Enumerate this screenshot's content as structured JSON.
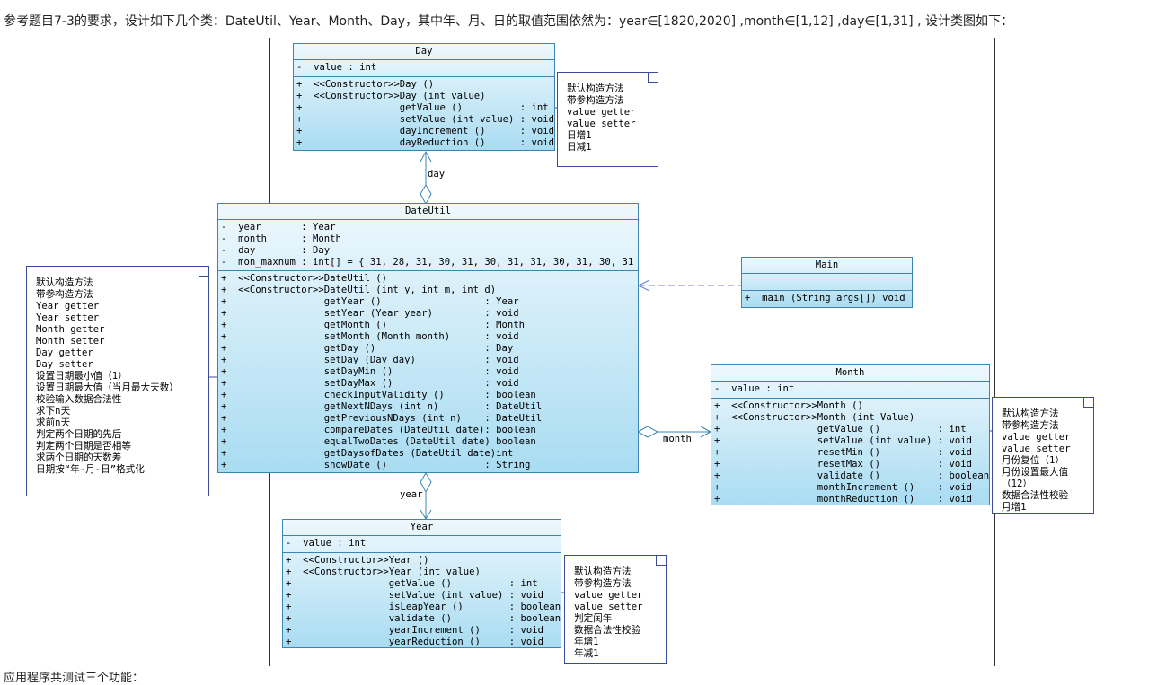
{
  "intro_text": "参考题目7-3的要求，设计如下几个类：DateUtil、Year、Month、Day，其中年、月、日的取值范围依然为：year∈[1820,2020] ,month∈[1,12] ,day∈[1,31] , 设计类图如下：",
  "footer_text": "应用程序共测试三个功能：",
  "classes": {
    "day": {
      "name": "Day",
      "attributes": [
        "-  value : int"
      ],
      "methods": [
        "+  <<Constructor>>Day ()",
        "+  <<Constructor>>Day (int value)",
        "+                 getValue ()          : int",
        "+                 setValue (int value) : void",
        "+                 dayIncrement ()      : void",
        "+                 dayReduction ()      : void"
      ]
    },
    "dateutil": {
      "name": "DateUtil",
      "attributes": [
        "-  year       : Year",
        "-  month      : Month",
        "-  day        : Day",
        "-  mon_maxnum : int[] = { 31, 28, 31, 30, 31, 30, 31, 31, 30, 31, 30, 31 }"
      ],
      "methods": [
        "+  <<Constructor>>DateUtil ()",
        "+  <<Constructor>>DateUtil (int y, int m, int d)",
        "+                 getYear ()                  : Year",
        "+                 setYear (Year year)         : void",
        "+                 getMonth ()                 : Month",
        "+                 setMonth (Month month)      : void",
        "+                 getDay ()                   : Day",
        "+                 setDay (Day day)            : void",
        "+                 setDayMin ()                : void",
        "+                 setDayMax ()                : void",
        "+                 checkInputValidity ()       : boolean",
        "+                 getNextNDays (int n)        : DateUtil",
        "+                 getPreviousNDays (int n)    : DateUtil",
        "+                 compareDates (DateUtil date): boolean",
        "+                 equalTwoDates (DateUtil date) boolean",
        "+                 getDaysofDates (DateUtil date)int",
        "+                 showDate ()                 : String"
      ]
    },
    "main": {
      "name": "Main",
      "attributes": [],
      "methods": [
        "+  main (String args[]) void"
      ]
    },
    "month": {
      "name": "Month",
      "attributes": [
        "-  value : int"
      ],
      "methods": [
        "+  <<Constructor>>Month ()",
        "+  <<Constructor>>Month (int Value)",
        "+                 getValue ()          : int",
        "+                 setValue (int value) : void",
        "+                 resetMin ()          : void",
        "+                 resetMax ()          : void",
        "+                 validate ()          : boolean",
        "+                 monthIncrement ()    : void",
        "+                 monthReduction ()    : void"
      ]
    },
    "year": {
      "name": "Year",
      "attributes": [
        "-  value : int"
      ],
      "methods": [
        "+  <<Constructor>>Year ()",
        "+  <<Constructor>>Year (int value)",
        "+                 getValue ()          : int",
        "+                 setValue (int value) : void",
        "+                 isLeapYear ()        : boolean",
        "+                 validate ()          : boolean",
        "+                 yearIncrement ()     : void",
        "+                 yearReduction ()     : void"
      ]
    }
  },
  "notes": {
    "day": [
      "默认构造方法",
      "带参构造方法",
      "value getter",
      "value setter",
      "日增1",
      "日减1"
    ],
    "dateutil": [
      "默认构造方法",
      "带参构造方法",
      "Year getter",
      "Year setter",
      "Month getter",
      "Month setter",
      "Day getter",
      "Day setter",
      "设置日期最小值（1）",
      "设置日期最大值（当月最大天数）",
      "校验输入数据合法性",
      "求下n天",
      "求前n天",
      "判定两个日期的先后",
      "判定两个日期是否相等",
      "求两个日期的天数差",
      "日期按“年-月-日”格式化"
    ],
    "month": [
      "默认构造方法",
      "带参构造方法",
      "value getter",
      "value setter",
      "月份复位（1）",
      "月份设置最大值",
      "（12）",
      "数据合法性校验",
      "月增1",
      "月减1"
    ],
    "year": [
      "默认构造方法",
      "带参构造方法",
      "value getter",
      "value setter",
      "判定闰年",
      "数据合法性校验",
      "年增1",
      "年减1"
    ]
  },
  "relations": {
    "day_label": "day",
    "month_label": "month",
    "year_label": "year"
  },
  "colors": {
    "class_fill_top": "#eef8fd",
    "class_fill_bottom": "#a9dcf2",
    "class_border": "#3b84b3",
    "note_border": "#3b4a9b",
    "dependency_line": "#6c7fd6"
  }
}
